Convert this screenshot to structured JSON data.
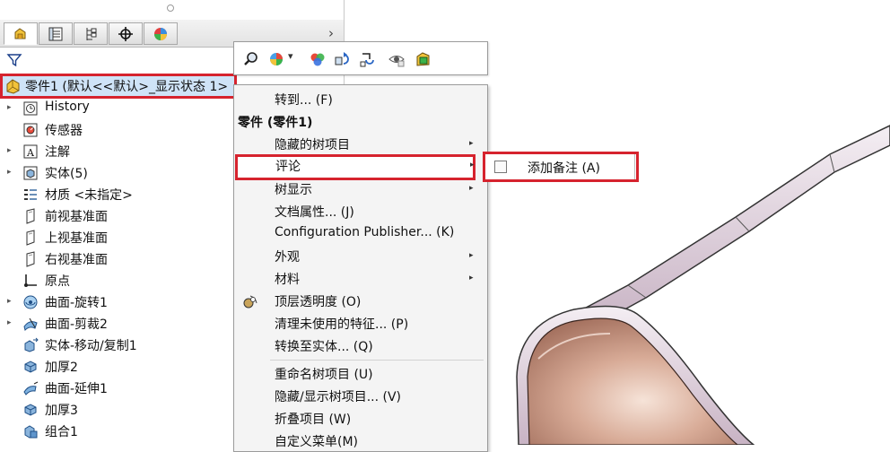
{
  "panel": {
    "tabs": [
      {
        "icon": "featuremanager-icon",
        "active": true
      },
      {
        "icon": "propertymanager-icon",
        "active": false
      },
      {
        "icon": "configurationmanager-icon",
        "active": false
      },
      {
        "icon": "dimxpert-icon",
        "active": false
      },
      {
        "icon": "displaymanager-icon",
        "active": false
      }
    ],
    "more_label": "›",
    "root_label": "零件1 (默认<<默认>_显示状态 1>",
    "tree": [
      {
        "label": "History",
        "icon": "history-icon",
        "expandable": true
      },
      {
        "label": "传感器",
        "icon": "sensor-icon",
        "expandable": false
      },
      {
        "label": "注解",
        "icon": "annotation-icon",
        "expandable": true
      },
      {
        "label": "实体(5)",
        "icon": "solid-bodies-icon",
        "expandable": true
      },
      {
        "label": "材质 <未指定>",
        "icon": "material-icon",
        "expandable": false
      },
      {
        "label": "前视基准面",
        "icon": "plane-icon",
        "expandable": false
      },
      {
        "label": "上视基准面",
        "icon": "plane-icon",
        "expandable": false
      },
      {
        "label": "右视基准面",
        "icon": "plane-icon",
        "expandable": false
      },
      {
        "label": "原点",
        "icon": "origin-icon",
        "expandable": false
      },
      {
        "label": "曲面-旋转1",
        "icon": "surface-revolve-icon",
        "expandable": true
      },
      {
        "label": "曲面-剪裁2",
        "icon": "surface-trim-icon",
        "expandable": true
      },
      {
        "label": "实体-移动/复制1",
        "icon": "move-copy-icon",
        "expandable": false
      },
      {
        "label": "加厚2",
        "icon": "thicken-icon",
        "expandable": false
      },
      {
        "label": "曲面-延伸1",
        "icon": "surface-extend-icon",
        "expandable": false
      },
      {
        "label": "加厚3",
        "icon": "thicken-icon",
        "expandable": false
      },
      {
        "label": "组合1",
        "icon": "combine-icon",
        "expandable": false
      }
    ]
  },
  "toolbar": {
    "buttons": [
      "zoom-to-selection-icon",
      "appearance-icon",
      "display-style-icon",
      "rebuild-icon",
      "rollback-icon",
      "hide-show-icon",
      "edit-part-icon"
    ],
    "dropdown_arrow": "▾"
  },
  "menu": {
    "items": [
      {
        "type": "item",
        "label": "转到... (F)"
      },
      {
        "type": "header",
        "label": "零件 (零件1)"
      },
      {
        "type": "item",
        "label": "隐藏的树项目",
        "submenu": true
      },
      {
        "type": "item",
        "label": "评论",
        "submenu": true,
        "highlighted": true
      },
      {
        "type": "item",
        "label": "树显示",
        "submenu": true
      },
      {
        "type": "item",
        "label": "文档属性... (J)"
      },
      {
        "type": "item",
        "label": "Configuration Publisher... (K)"
      },
      {
        "type": "item",
        "label": "外观",
        "submenu": true
      },
      {
        "type": "item",
        "label": "材料",
        "submenu": true
      },
      {
        "type": "item",
        "label": "顶层透明度 (O)",
        "icon": "transparency-icon"
      },
      {
        "type": "item",
        "label": "清理未使用的特征... (P)"
      },
      {
        "type": "item",
        "label": "转换至实体... (Q)"
      },
      {
        "type": "separator"
      },
      {
        "type": "item",
        "label": "重命名树项目 (U)"
      },
      {
        "type": "item",
        "label": "隐藏/显示树项目... (V)"
      },
      {
        "type": "item",
        "label": "折叠项目 (W)"
      },
      {
        "type": "item",
        "label": "自定义菜单(M)"
      }
    ],
    "arrow": "▸"
  },
  "submenu": {
    "label": "添加备注 (A)"
  },
  "colors": {
    "highlight_border": "#d6232e",
    "selection": "#cfe3f7",
    "part_inner": "#c79a86",
    "part_rim": "#d9c3cc"
  }
}
